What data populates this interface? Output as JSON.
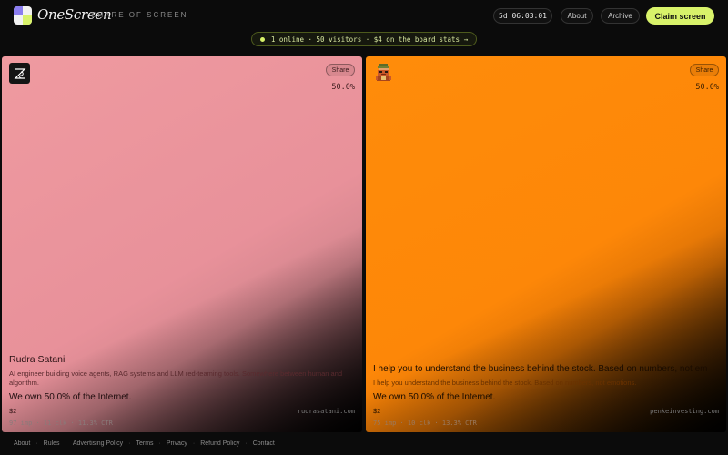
{
  "header": {
    "logo_text": "OneScreen",
    "tagline": "SHARE OF SCREEN",
    "countdown": "5d 06:03:01",
    "nav": {
      "about": "About",
      "archive": "Archive"
    },
    "claim_label": "Claim screen"
  },
  "stats": {
    "text": "1 online · 50 visitors · $4 on the board",
    "link": "stats →"
  },
  "panels": [
    {
      "avatar_glyph": "ZS",
      "avatar_icon": "user-monogram-icon",
      "share_label": "Share",
      "share_pct": "50.0%",
      "title": "Rudra Satani",
      "description": "AI engineer building voice agents, RAG systems and LLM red-teaming tools. Somewhere between human and algorithm.",
      "own": "We own 50.0% of the Internet.",
      "price": "$2",
      "domain": "rudrasatani.com",
      "metrics": "97 imp · 11 clk · 11.3% CTR",
      "bg_color": "#ef9aa0"
    },
    {
      "avatar_icon": "pixel-character-icon",
      "share_label": "Share",
      "share_pct": "50.0%",
      "title": "I help you to understand the business behind the stock. Based on numbers, not em",
      "description": "I help you understand the business behind the stock. Based on numbers, not emotions.",
      "own": "We own 50.0% of the Internet.",
      "price": "$2",
      "domain": "penkeinvesting.com",
      "metrics": "75 imp · 10 clk · 13.3% CTR",
      "bg_color": "#ff8c0a"
    }
  ],
  "footer": {
    "links": [
      "About",
      "Rules",
      "Advertising Policy",
      "Terms",
      "Privacy",
      "Refund Policy",
      "Contact"
    ]
  },
  "colors": {
    "accent": "#d8f26a",
    "background": "#0b0b0b"
  }
}
